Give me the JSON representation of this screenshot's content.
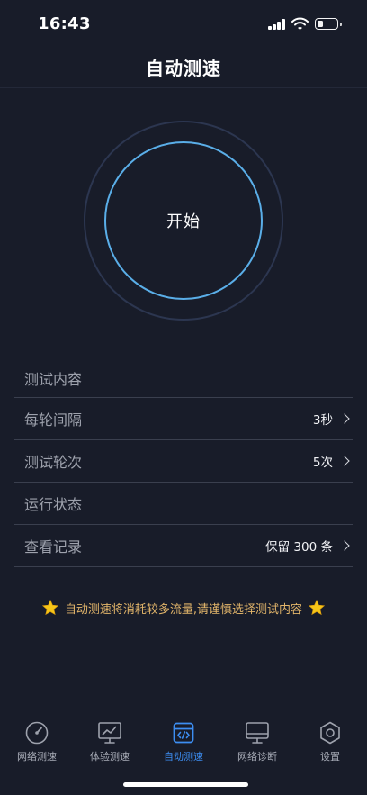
{
  "status_bar": {
    "time": "16:43",
    "battery_level": 0.3
  },
  "header": {
    "title": "自动测速"
  },
  "start_button": {
    "label": "开始"
  },
  "settings": [
    {
      "label": "测试内容",
      "value": ""
    },
    {
      "label": "每轮间隔",
      "value": "3秒"
    },
    {
      "label": "测试轮次",
      "value": "5次"
    },
    {
      "label": "运行状态",
      "value": ""
    },
    {
      "label": "查看记录",
      "value": "保留 300 条"
    }
  ],
  "warning": {
    "text": "自动测速将消耗较多流量,请谨慎选择测试内容"
  },
  "tabbar": {
    "items": [
      {
        "label": "网络测速",
        "icon": "speedometer-icon"
      },
      {
        "label": "体验测速",
        "icon": "chart-monitor-icon"
      },
      {
        "label": "自动测速",
        "icon": "code-window-icon",
        "active": true
      },
      {
        "label": "网络诊断",
        "icon": "monitor-icon"
      },
      {
        "label": "设置",
        "icon": "hexagon-gear-icon"
      }
    ]
  },
  "colors": {
    "background": "#181c29",
    "accent": "#3d8ef2",
    "ring": "#5aaee8",
    "warning": "#e2b56a"
  }
}
